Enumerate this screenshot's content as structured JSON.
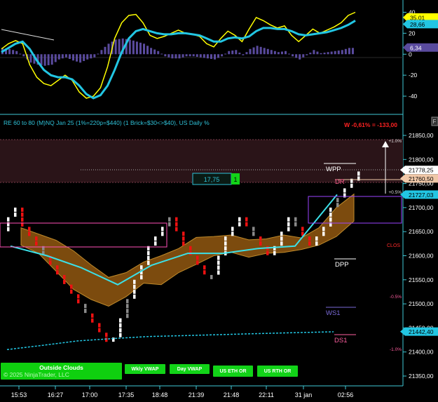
{
  "header": {
    "instrument_info": "RE 60 to 80 (M)NQ Jan 25 (1%=220p=$440) (1 Brick=$30<>$40), US Daily %",
    "change_text": "W -0,61% = -133,00",
    "corner_button": "F"
  },
  "oscillator": {
    "axis_ticks": [
      "40",
      "20",
      "0",
      "-20",
      "-40"
    ],
    "badges": [
      {
        "label": "35,01",
        "color": "#ffff00"
      },
      {
        "label": "28,66",
        "color": "#22c6e3"
      },
      {
        "label": "6,34",
        "color": "#5a4b9e"
      }
    ]
  },
  "price_axis": {
    "ticks": [
      "21850,00",
      "21800,00",
      "21750,00",
      "21700,00",
      "21650,00",
      "21600,00",
      "21550,00",
      "21500,00",
      "21450,00",
      "21400,00",
      "21350,00"
    ],
    "badges": [
      {
        "label": "21778,25",
        "color": "#ffffff"
      },
      {
        "label": "21760,50",
        "color": "#f0c8a8"
      },
      {
        "label": "21727,03",
        "color": "#22c6e3"
      },
      {
        "label": "21442,40",
        "color": "#22c6e3"
      }
    ]
  },
  "time_axis": {
    "ticks": [
      "15:53",
      "16:27",
      "17:00",
      "17:35",
      "18:48",
      "21:39",
      "21:48",
      "22:11",
      "31 jan",
      "02:56"
    ]
  },
  "levels": {
    "wpp": "WPP",
    "dr": "DR",
    "dpp": "DPP",
    "ws1": "WS1",
    "ds1": "DS1",
    "clo": "CLOS",
    "plus_one": "+1.0%",
    "plus_half": "+0.5%",
    "minus_half": "-0.5%",
    "minus_one": "-1.0%"
  },
  "order_box": {
    "value": "17,75",
    "qty": "1"
  },
  "buttons": {
    "outside_clouds": "Outside Clouds",
    "copyright": "© 2025 NinjaTrader, LLC",
    "wkly_vwap": "Wkly VWAP",
    "day_vwap": "Day VWAP",
    "us_eth_or": "US ETH OR",
    "us_rth_or": "US RTH OR"
  },
  "chart_data": [
    {
      "type": "line",
      "title": "",
      "ylim": [
        -50,
        45
      ],
      "x": [
        0,
        10,
        20,
        30,
        40,
        50,
        60,
        70,
        80,
        90,
        100,
        110,
        120,
        130,
        140,
        150,
        160,
        170,
        180,
        190,
        200,
        210,
        220,
        230,
        240,
        250,
        260,
        270,
        280,
        290,
        300,
        310,
        320,
        330,
        340,
        350,
        360,
        370,
        380,
        390,
        400,
        410,
        420,
        430,
        440,
        450,
        460,
        470,
        480,
        490,
        500
      ],
      "series": [
        {
          "values": [
            5,
            10,
            13,
            10,
            -10,
            -22,
            -28,
            -30,
            -25,
            -20,
            -25,
            -36,
            -42,
            -40,
            -32,
            -12,
            15,
            30,
            37,
            38,
            30,
            18,
            15,
            17,
            20,
            23,
            20,
            19,
            17,
            10,
            7,
            15,
            22,
            18,
            12,
            24,
            35,
            32,
            28,
            25,
            27,
            18,
            12,
            18,
            24,
            20,
            23,
            26,
            30,
            37,
            40
          ]
        },
        {
          "values": [
            2,
            6,
            10,
            12,
            5,
            -6,
            -15,
            -20,
            -22,
            -22,
            -24,
            -30,
            -38,
            -42,
            -39,
            -30,
            -15,
            2,
            15,
            22,
            24,
            22,
            20,
            19,
            19,
            20,
            20,
            19,
            18,
            15,
            12,
            12,
            15,
            16,
            15,
            17,
            22,
            25,
            25,
            24,
            24,
            22,
            19,
            18,
            19,
            20,
            21,
            23,
            25,
            28,
            32
          ]
        },
        {
          "values": [
            6,
            5,
            3,
            -2,
            -8,
            -10,
            -11,
            -10,
            -5,
            -3,
            -6,
            -8,
            -5,
            -3,
            4,
            10,
            14,
            15,
            14,
            12,
            10,
            6,
            3,
            -2,
            -4,
            -4,
            -2,
            -2,
            -3,
            -4,
            -5,
            -2,
            3,
            4,
            -1,
            5,
            8,
            6,
            4,
            2,
            3,
            -2,
            -5,
            -1,
            4,
            1,
            2,
            3,
            4,
            6,
            6
          ]
        }
      ]
    },
    {
      "type": "bar",
      "title": "",
      "ylim": [
        21330,
        21880
      ],
      "categories": [
        "15:53",
        "16:27",
        "17:00",
        "17:35",
        "18:48",
        "21:39",
        "21:48",
        "22:11",
        "31 jan",
        "02:56"
      ],
      "series": [
        {
          "values": [
            21680,
            21530,
            21430,
            21560,
            21600,
            21660,
            21600,
            21650,
            21660,
            21770
          ]
        },
        {
          "values": [
            21620,
            21600,
            21575,
            21540,
            21580,
            21605,
            21605,
            21615,
            21620,
            21727
          ]
        },
        {
          "values": [
            21405,
            21414,
            21423,
            21428,
            21432,
            21434,
            21436,
            21438,
            21440,
            21442
          ]
        }
      ]
    }
  ]
}
